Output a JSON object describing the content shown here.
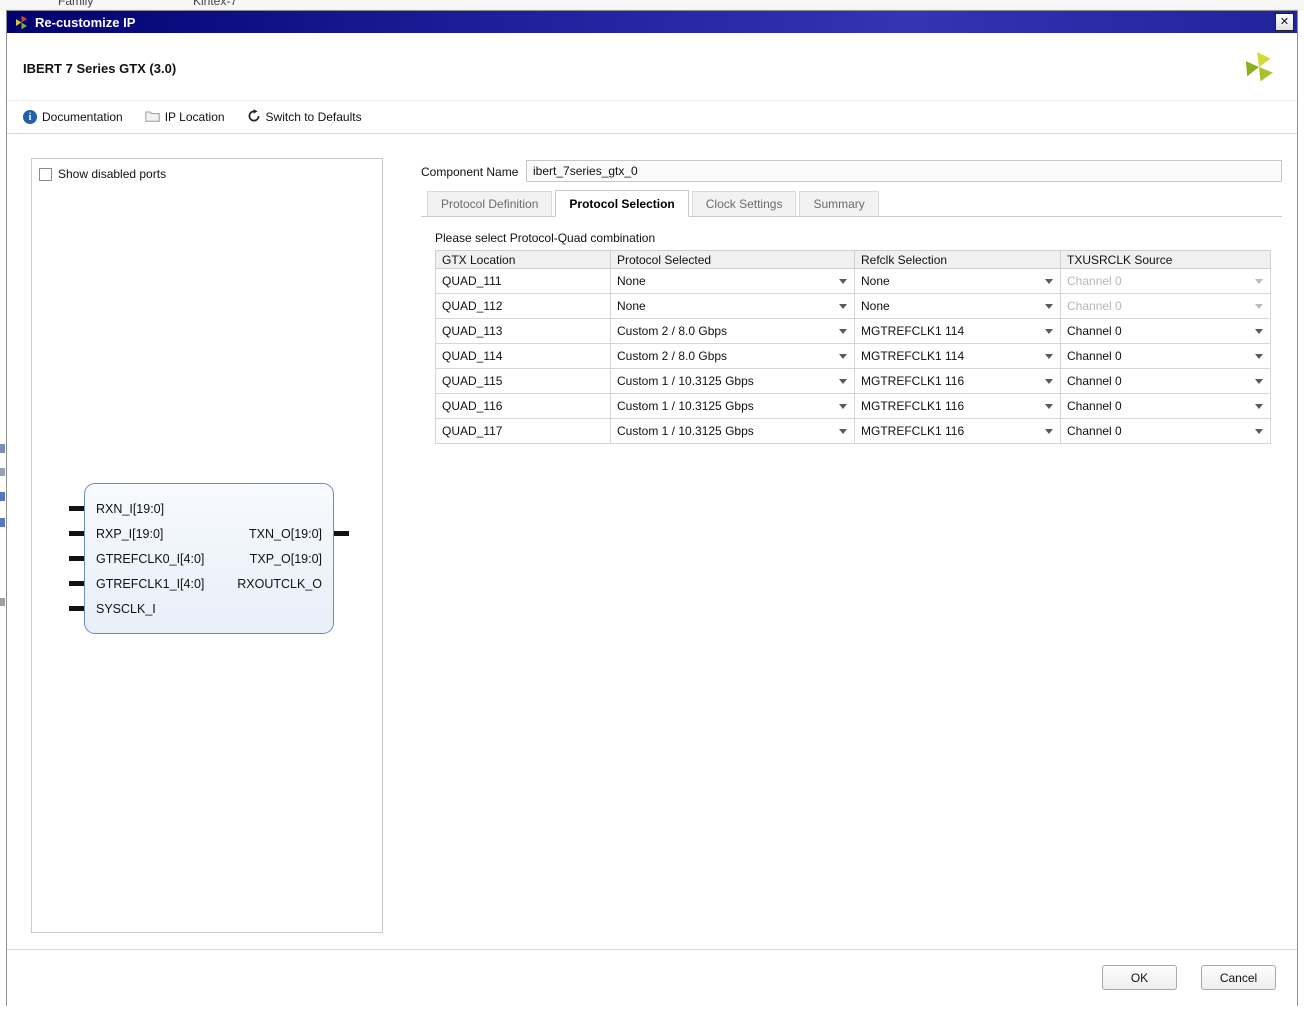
{
  "background": {
    "fragments": [
      "Family",
      "Kintex-7"
    ]
  },
  "colors": {
    "titlebar_blue": "#20209d",
    "logo_green": "#a8c32a",
    "disabled_text": "#b7b7b7",
    "symbol_border_blue": "#6b8cb8"
  },
  "titlebar": {
    "title": "Re-customize IP",
    "close_icon": "✕"
  },
  "header": {
    "title": "IBERT 7 Series GTX (3.0)"
  },
  "toolbar": {
    "info_glyph": "i",
    "documentation_label": "Documentation",
    "ip_location_label": "IP Location",
    "switch_to_defaults_label": "Switch to Defaults"
  },
  "left_panel": {
    "show_disabled_ports_label": "Show disabled ports",
    "ip_symbol": {
      "rows": [
        {
          "left": "RXN_I[19:0]",
          "right": "",
          "left_stub": true,
          "right_stub": false
        },
        {
          "left": "RXP_I[19:0]",
          "right": "TXN_O[19:0]",
          "left_stub": true,
          "right_stub": true
        },
        {
          "left": "GTREFCLK0_I[4:0]",
          "right": "TXP_O[19:0]",
          "left_stub": true,
          "right_stub": false
        },
        {
          "left": "GTREFCLK1_I[4:0]",
          "right": "RXOUTCLK_O",
          "left_stub": true,
          "right_stub": false
        },
        {
          "left": "SYSCLK_I",
          "right": "",
          "left_stub": true,
          "right_stub": false
        }
      ]
    }
  },
  "component_name": {
    "label": "Component Name",
    "value": "ibert_7series_gtx_0"
  },
  "tabs": [
    {
      "label": "Protocol Definition",
      "active": false
    },
    {
      "label": "Protocol Selection",
      "active": true
    },
    {
      "label": "Clock Settings",
      "active": false
    },
    {
      "label": "Summary",
      "active": false
    }
  ],
  "protocol_selection": {
    "instruction": "Please select Protocol-Quad combination",
    "columns": [
      "GTX Location",
      "Protocol Selected",
      "Refclk Selection",
      "TXUSRCLK Source"
    ],
    "rows": [
      {
        "quad": "QUAD_111",
        "protocol": "None",
        "refclk": "None",
        "txusrclk": "Channel 0",
        "txusrclk_disabled": true
      },
      {
        "quad": "QUAD_112",
        "protocol": "None",
        "refclk": "None",
        "txusrclk": "Channel 0",
        "txusrclk_disabled": true
      },
      {
        "quad": "QUAD_113",
        "protocol": "Custom 2 / 8.0 Gbps",
        "refclk": "MGTREFCLK1 114",
        "txusrclk": "Channel 0",
        "txusrclk_disabled": false
      },
      {
        "quad": "QUAD_114",
        "protocol": "Custom 2 / 8.0 Gbps",
        "refclk": "MGTREFCLK1 114",
        "txusrclk": "Channel 0",
        "txusrclk_disabled": false
      },
      {
        "quad": "QUAD_115",
        "protocol": "Custom 1 / 10.3125 Gbps",
        "refclk": "MGTREFCLK1 116",
        "txusrclk": "Channel 0",
        "txusrclk_disabled": false
      },
      {
        "quad": "QUAD_116",
        "protocol": "Custom 1 / 10.3125 Gbps",
        "refclk": "MGTREFCLK1 116",
        "txusrclk": "Channel 0",
        "txusrclk_disabled": false
      },
      {
        "quad": "QUAD_117",
        "protocol": "Custom 1 / 10.3125 Gbps",
        "refclk": "MGTREFCLK1 116",
        "txusrclk": "Channel 0",
        "txusrclk_disabled": false
      }
    ]
  },
  "footer": {
    "ok_label": "OK",
    "cancel_label": "Cancel"
  }
}
